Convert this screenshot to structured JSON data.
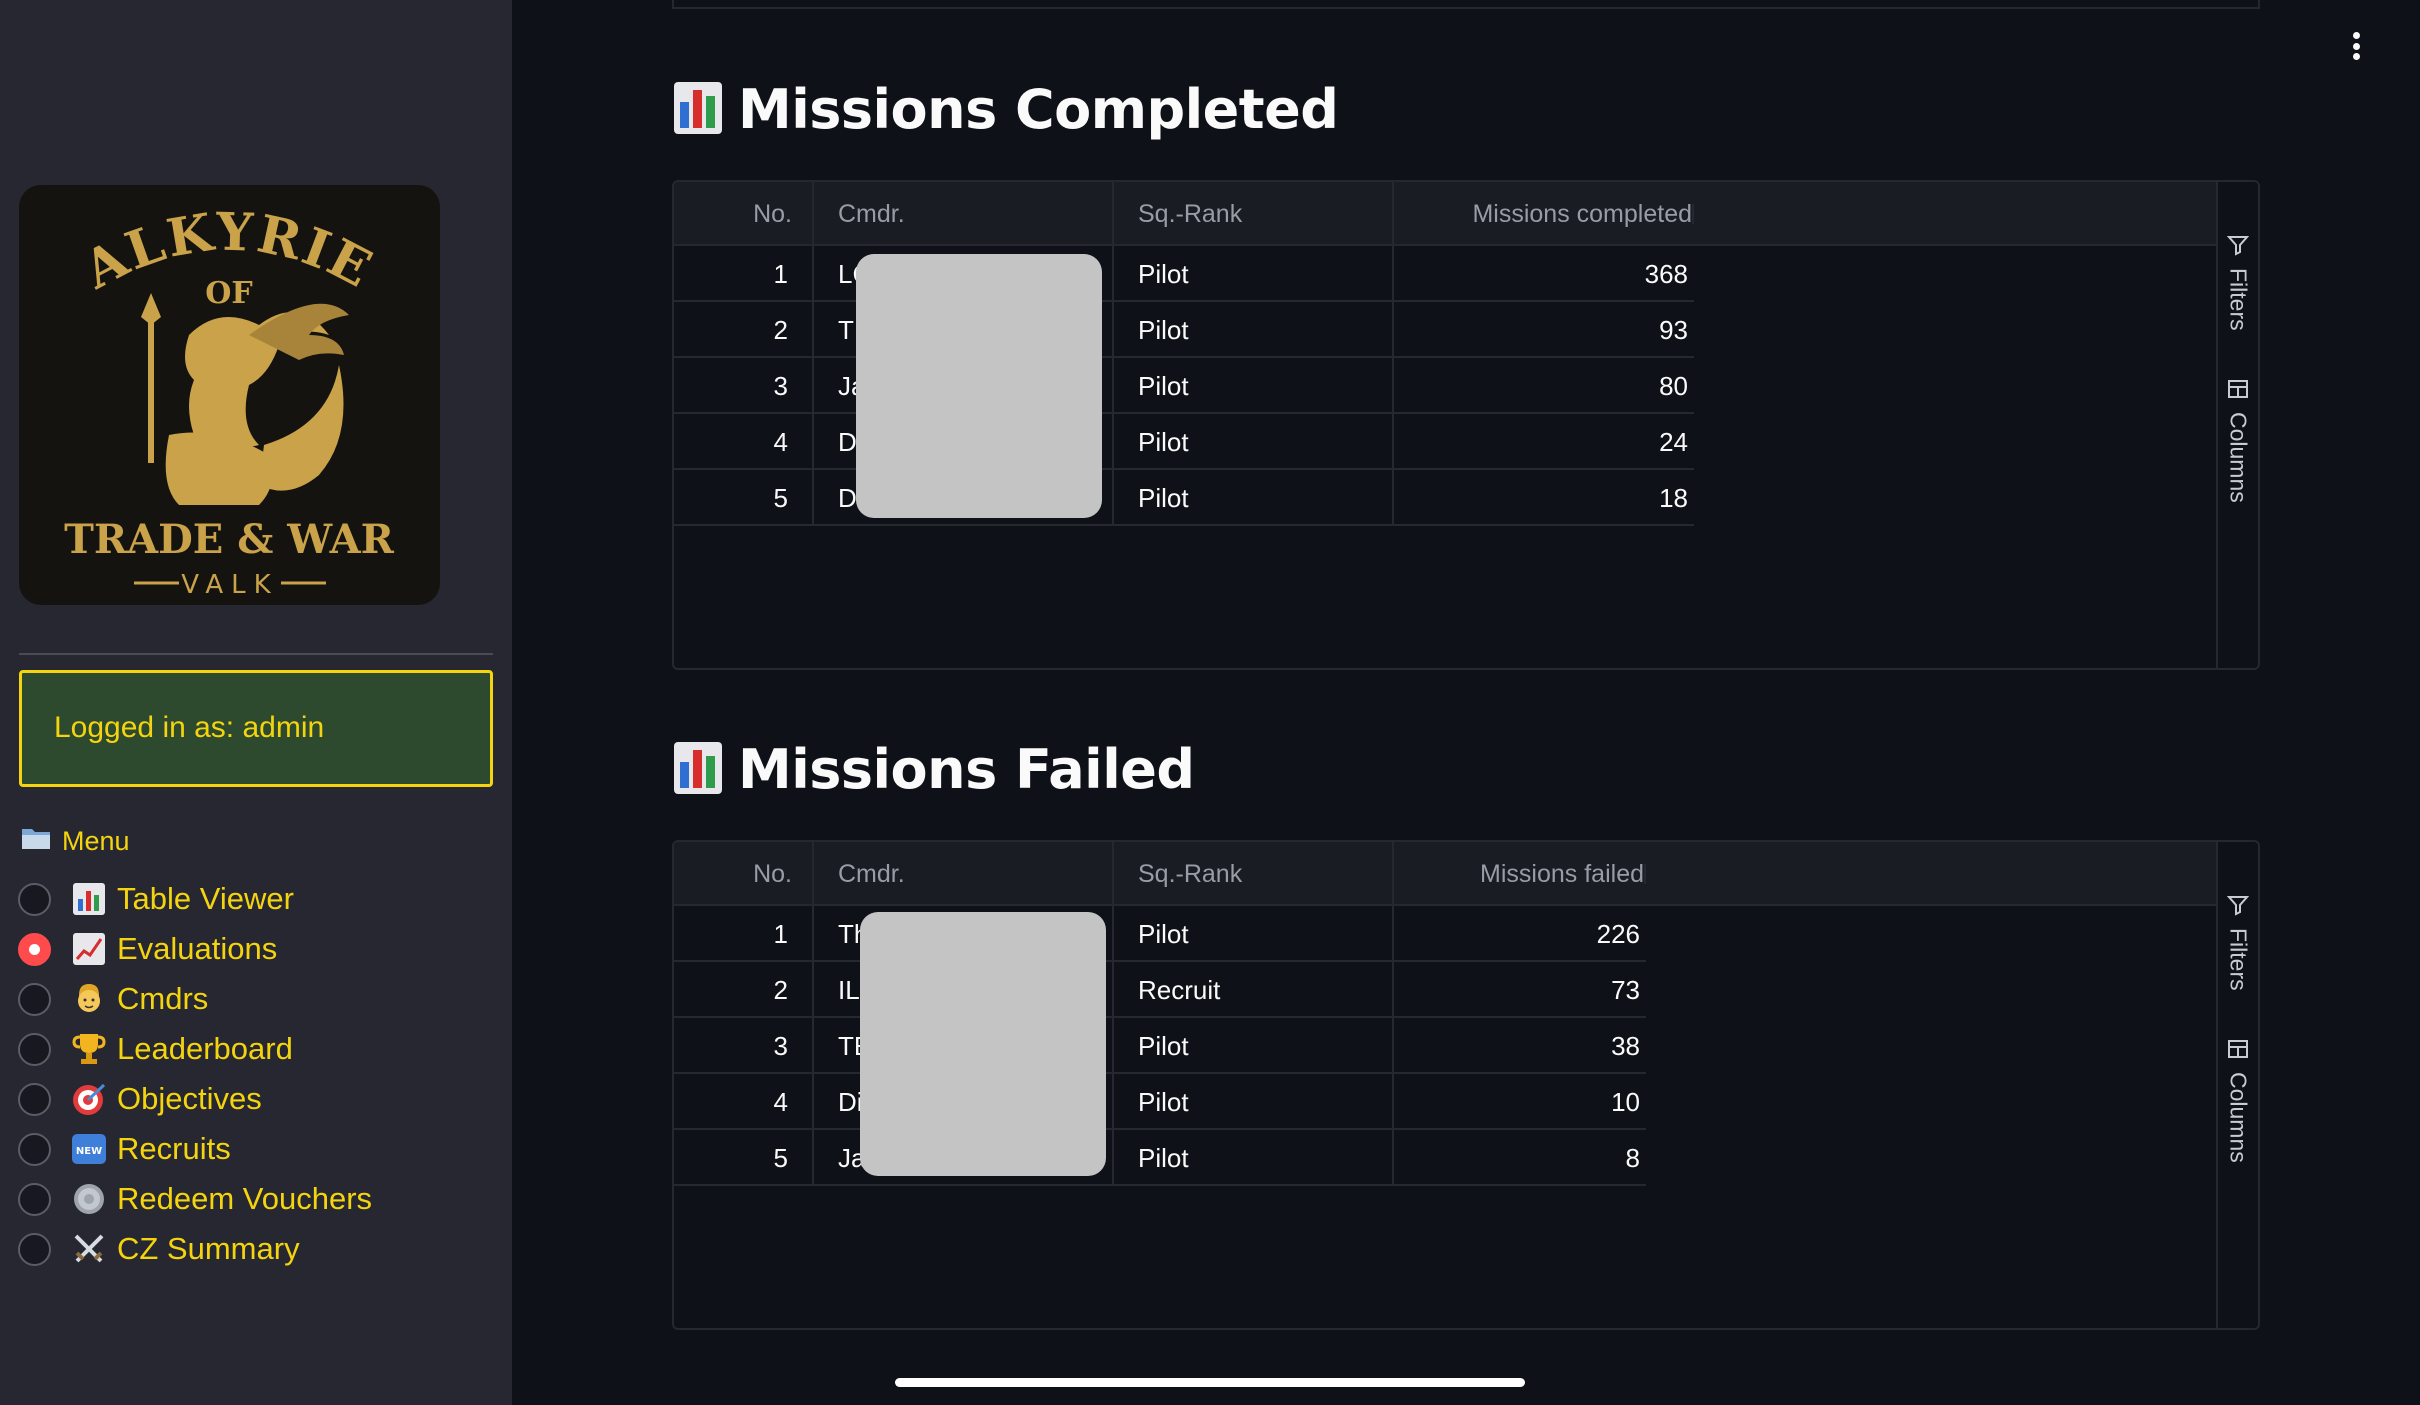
{
  "sidebar": {
    "logo": {
      "line1": "VALKYRIES",
      "line2": "OF",
      "line3": "TRADE & WAR",
      "line4": "VALK"
    },
    "login_text": "Logged in as: admin",
    "menu_title": "Menu",
    "menu_items": [
      {
        "label": "Table Viewer",
        "icon": "bar-chart-icon",
        "checked": false
      },
      {
        "label": "Evaluations",
        "icon": "trend-chart-icon",
        "checked": true
      },
      {
        "label": "Cmdrs",
        "icon": "person-icon",
        "checked": false
      },
      {
        "label": "Leaderboard",
        "icon": "trophy-icon",
        "checked": false
      },
      {
        "label": "Objectives",
        "icon": "target-icon",
        "checked": false
      },
      {
        "label": "Recruits",
        "icon": "new-badge-icon",
        "checked": false
      },
      {
        "label": "Redeem Vouchers",
        "icon": "coin-icon",
        "checked": false
      },
      {
        "label": "CZ Summary",
        "icon": "crossed-swords-icon",
        "checked": false
      }
    ]
  },
  "completed": {
    "title": "Missions Completed",
    "headers": [
      "No.",
      "Cmdr.",
      "Sq.-Rank",
      "Missions completed"
    ],
    "rows": [
      {
        "no": "1",
        "cmdr": "LC",
        "rank": "Pilot",
        "value": "368"
      },
      {
        "no": "2",
        "cmdr": "TI",
        "rank": "Pilot",
        "value": "93"
      },
      {
        "no": "3",
        "cmdr": "Ja",
        "rank": "Pilot",
        "value": "80"
      },
      {
        "no": "4",
        "cmdr": "D",
        "rank": "Pilot",
        "value": "24"
      },
      {
        "no": "5",
        "cmdr": "D",
        "rank": "Pilot",
        "value": "18"
      }
    ]
  },
  "failed": {
    "title": "Missions Failed",
    "headers": [
      "No.",
      "Cmdr.",
      "Sq.-Rank",
      "Missions failed"
    ],
    "rows": [
      {
        "no": "1",
        "cmdr": "Th",
        "rank": "Pilot",
        "value": "226"
      },
      {
        "no": "2",
        "cmdr": "IL",
        "rank": "Recruit",
        "value": "73"
      },
      {
        "no": "3",
        "cmdr": "TE",
        "rank": "Pilot",
        "value": "38"
      },
      {
        "no": "4",
        "cmdr": "Di",
        "rank": "Pilot",
        "value": "10"
      },
      {
        "no": "5",
        "cmdr": "Ja",
        "rank": "Pilot",
        "value": "8"
      }
    ]
  },
  "toolbar": {
    "filters_label": "Filters",
    "columns_label": "Columns"
  },
  "colors": {
    "accent": "#f4d40f",
    "login_bg": "#2d4a2f",
    "radio_active": "#ff4b4b",
    "sidebar_bg": "#262730",
    "main_bg": "#0e1117"
  }
}
